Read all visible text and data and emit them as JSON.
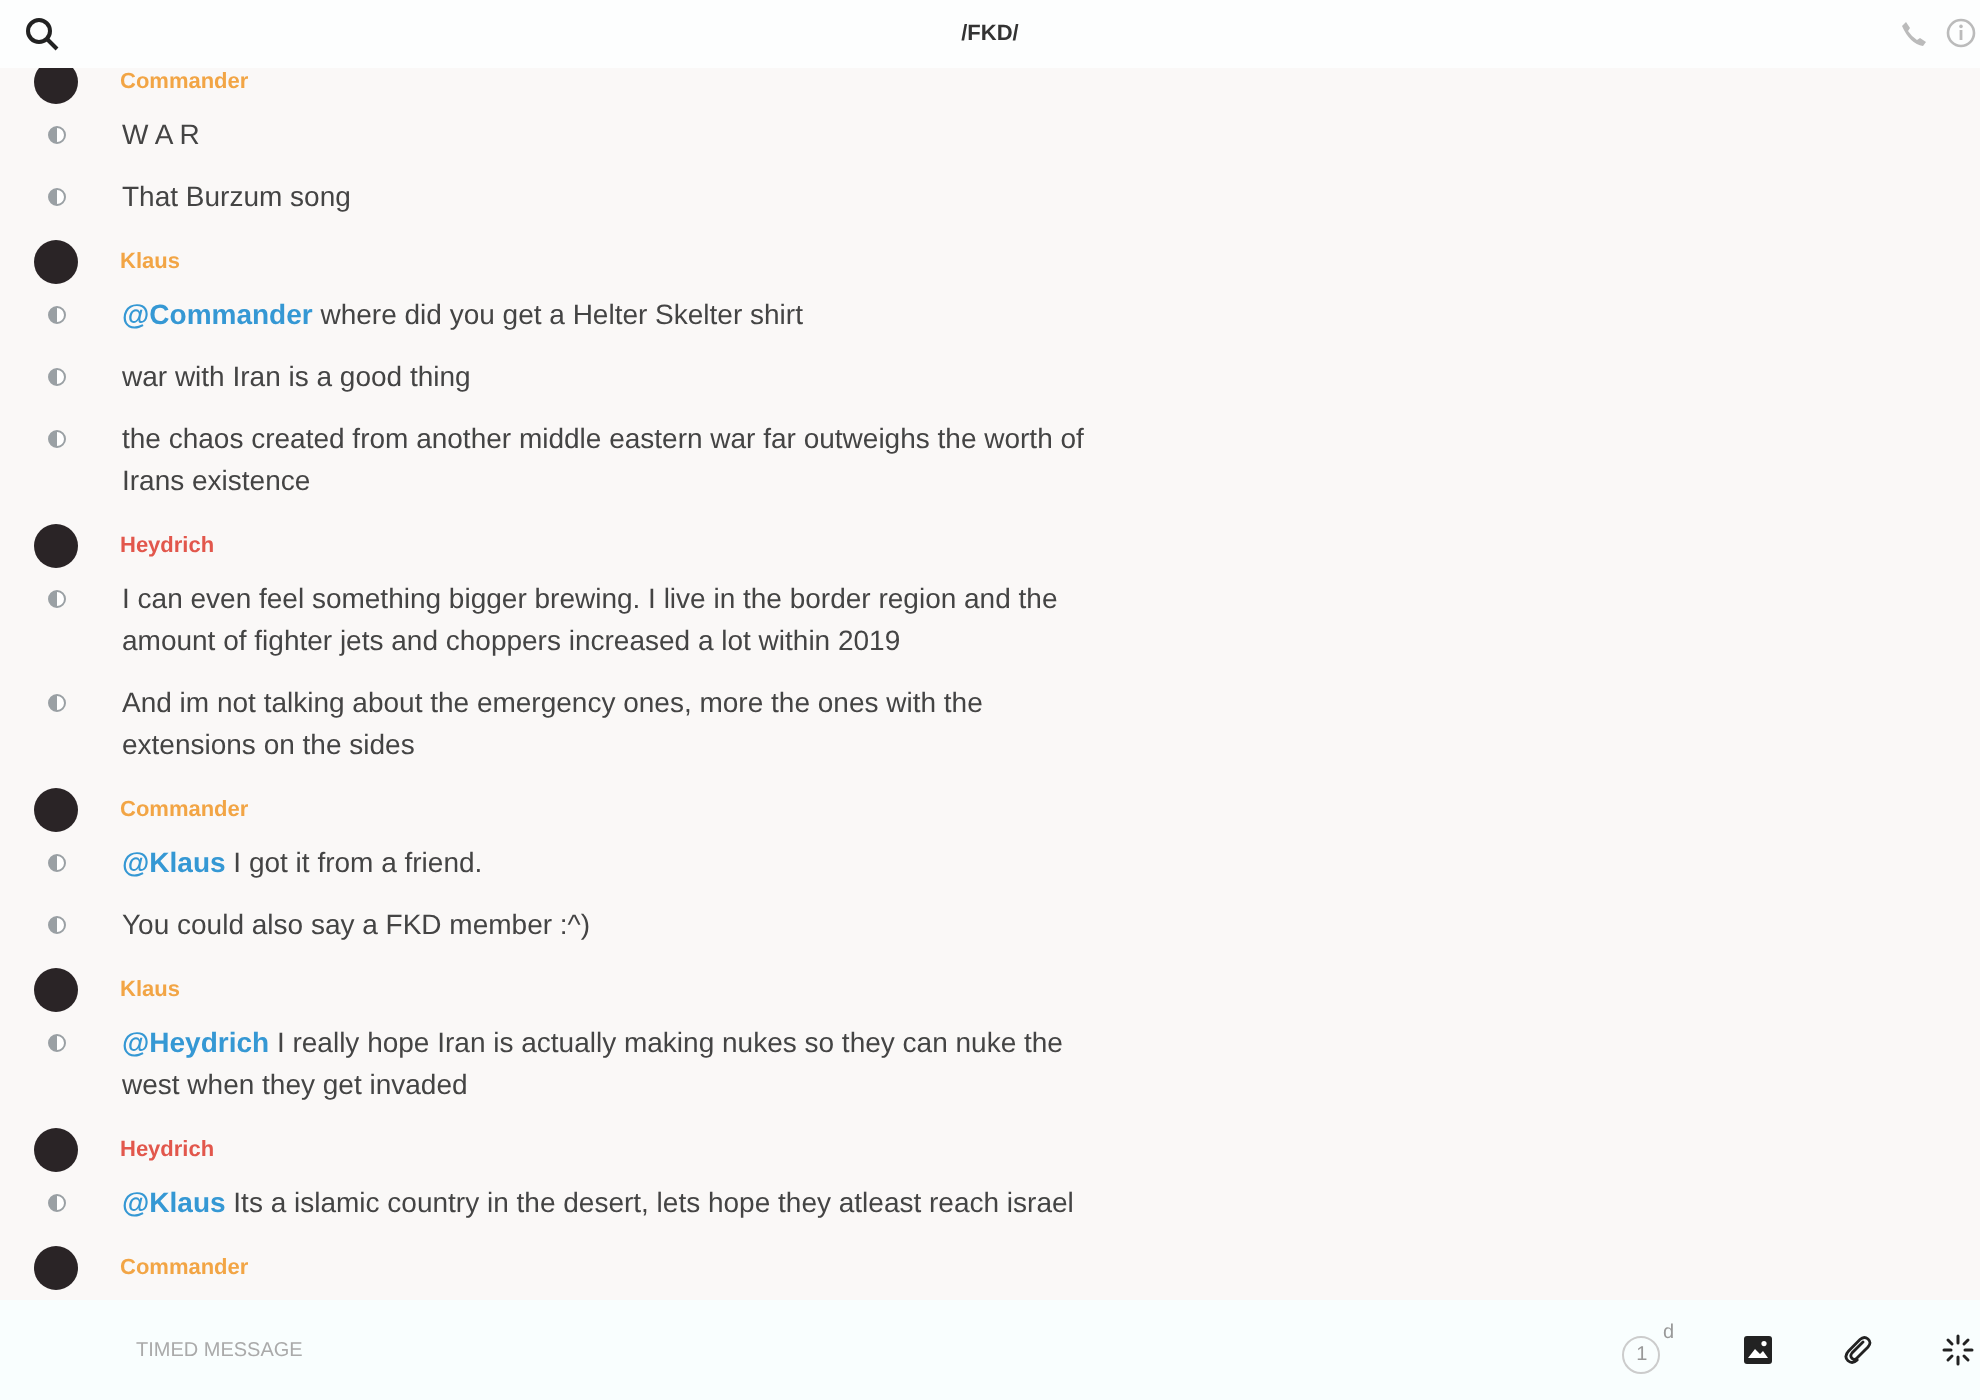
{
  "header": {
    "title": "/FKD/"
  },
  "groups": [
    {
      "sender": "Commander",
      "color": "#f2a545",
      "messages": [
        {
          "text": "W A R"
        },
        {
          "text": "That Burzum song"
        }
      ]
    },
    {
      "sender": "Klaus",
      "color": "#f2a545",
      "messages": [
        {
          "mention": "@Commander",
          "text": " where did you get a Helter Skelter shirt"
        },
        {
          "text": "war with Iran is a good thing"
        },
        {
          "text": "the chaos created from another middle eastern war far outweighs the worth of Irans existence"
        }
      ]
    },
    {
      "sender": "Heydrich",
      "color": "#e2574c",
      "messages": [
        {
          "text": "I can even feel something bigger brewing. I live in the border region and the amount of fighter jets and choppers increased a lot within 2019"
        },
        {
          "text": "And im not talking about the emergency ones, more the ones with the extensions on the sides"
        }
      ]
    },
    {
      "sender": "Commander",
      "color": "#f2a545",
      "messages": [
        {
          "mention": "@Klaus",
          "text": " I got it from a friend."
        },
        {
          "text": "You could also say a FKD member :^)"
        }
      ]
    },
    {
      "sender": "Klaus",
      "color": "#f2a545",
      "messages": [
        {
          "mention": "@Heydrich",
          "text": " I really hope Iran is actually making nukes so they can nuke the west when they get invaded"
        }
      ]
    },
    {
      "sender": "Heydrich",
      "color": "#e2574c",
      "messages": [
        {
          "mention": "@Klaus",
          "text": " Its a islamic country in the desert, lets hope they atleast reach israel"
        }
      ]
    },
    {
      "sender": "Commander",
      "color": "#f2a545"
    }
  ],
  "composer": {
    "placeholder": "TIMED MESSAGE",
    "timer_value": "1",
    "timer_unit": "d"
  }
}
